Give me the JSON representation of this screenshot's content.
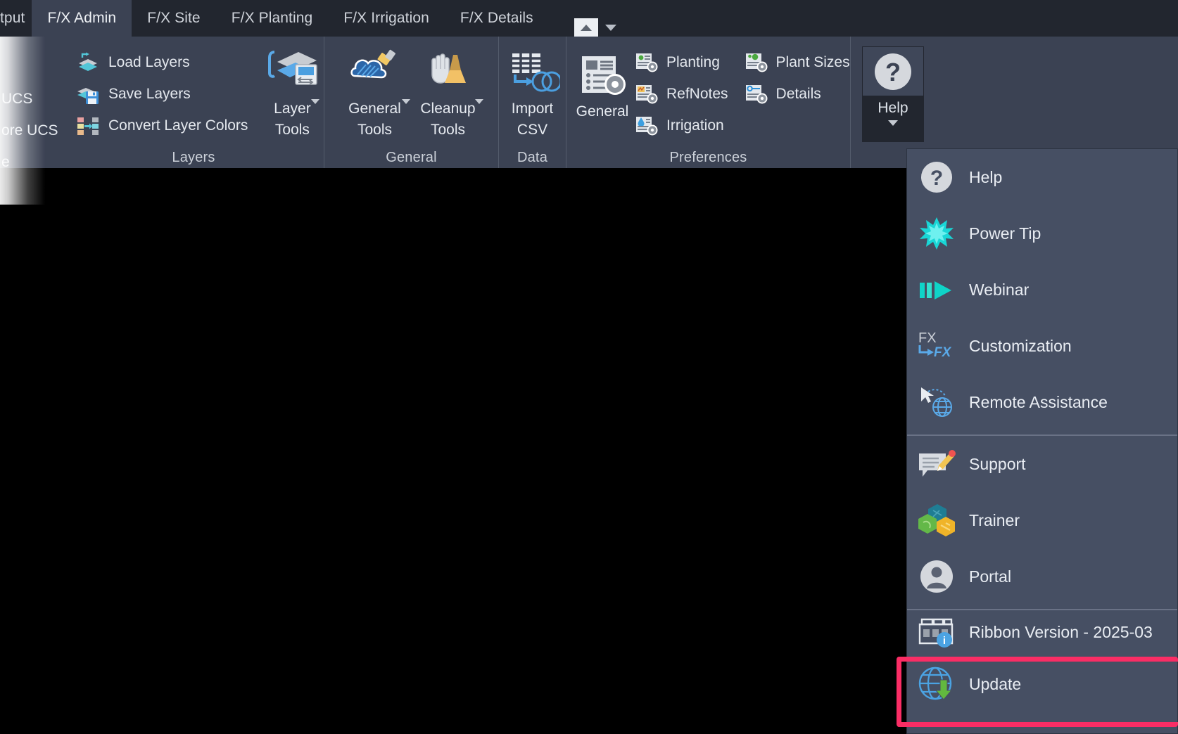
{
  "window": {
    "app_theme_bg": "#3b4253",
    "canvas_bg": "#000000",
    "accent_highlight": "#fa2d65"
  },
  "tabbar": {
    "partial_tab": "tput",
    "tabs": [
      {
        "label": "F/X Admin",
        "active": true
      },
      {
        "label": "F/X Site",
        "active": false
      },
      {
        "label": "F/X Planting",
        "active": false
      },
      {
        "label": "F/X Irrigation",
        "active": false
      },
      {
        "label": "F/X Details",
        "active": false
      }
    ],
    "collapse_icon": "caret-up-icon",
    "dropdown_icon": "chevron-down-icon"
  },
  "left_stub": {
    "items": [
      "UCS",
      "ore UCS",
      "e"
    ]
  },
  "ribbon": {
    "panels": [
      {
        "title": "Layers",
        "small_buttons": [
          {
            "label": "Load Layers",
            "icon": "load-layers-icon"
          },
          {
            "label": "Save Layers",
            "icon": "save-layers-icon"
          },
          {
            "label": "Convert Layer Colors",
            "icon": "convert-layer-colors-icon"
          }
        ],
        "big_buttons": [
          {
            "label_line1": "Layer",
            "label_line2": "Tools",
            "icon": "layer-tools-icon",
            "has_dropdown": true
          }
        ]
      },
      {
        "title": "General",
        "small_buttons": [],
        "big_buttons": [
          {
            "label_line1": "General",
            "label_line2": "Tools",
            "icon": "general-tools-icon",
            "has_dropdown": true
          },
          {
            "label_line1": "Cleanup",
            "label_line2": "Tools",
            "icon": "cleanup-tools-icon",
            "has_dropdown": true
          }
        ]
      },
      {
        "title": "Data",
        "small_buttons": [],
        "big_buttons": [
          {
            "label_line1": "Import",
            "label_line2": "CSV",
            "icon": "import-csv-icon",
            "has_dropdown": false
          }
        ]
      },
      {
        "title": "Preferences",
        "small_buttons": [
          {
            "label": "Planting",
            "icon": "planting-prefs-icon"
          },
          {
            "label": "RefNotes",
            "icon": "refnotes-prefs-icon"
          },
          {
            "label": "Irrigation",
            "icon": "irrigation-prefs-icon"
          },
          {
            "label": "Plant Sizes",
            "icon": "plant-sizes-prefs-icon"
          },
          {
            "label": "Details",
            "icon": "details-prefs-icon"
          }
        ],
        "big_buttons": [
          {
            "label_line1": "General",
            "label_line2": "",
            "icon": "general-prefs-icon",
            "has_dropdown": false
          }
        ]
      }
    ],
    "help_button": {
      "label": "Help",
      "icon": "question-mark-icon",
      "expanded": true
    }
  },
  "help_menu": {
    "items": [
      {
        "label": "Help",
        "icon": "question-mark-icon",
        "highlighted": false
      },
      {
        "label": "Power Tip",
        "icon": "starburst-icon",
        "highlighted": false
      },
      {
        "label": "Webinar",
        "icon": "play-media-icon",
        "highlighted": false
      },
      {
        "label": "Customization",
        "icon": "fx-customization-icon",
        "highlighted": false
      },
      {
        "label": "Remote Assistance",
        "icon": "cursor-globe-icon",
        "highlighted": false
      },
      {
        "label": "Support",
        "icon": "support-pencil-icon",
        "highlighted": false
      },
      {
        "label": "Trainer",
        "icon": "trainer-hexagons-icon",
        "highlighted": false
      },
      {
        "label": "Portal",
        "icon": "user-avatar-icon",
        "highlighted": false
      },
      {
        "label": "Ribbon Version - 2025-03",
        "icon": "ribbon-info-icon",
        "highlighted": false
      },
      {
        "label": "Update",
        "icon": "globe-download-icon",
        "highlighted": true
      }
    ]
  }
}
